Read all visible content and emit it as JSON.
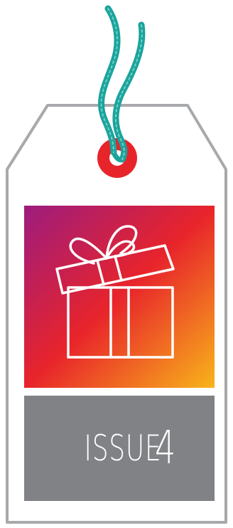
{
  "tag": {
    "issue_word": "ISSUE",
    "issue_number": "4"
  },
  "colors": {
    "tag_outline": "#a7a9ac",
    "tag_fill": "#ffffff",
    "grommet": "#e8242b",
    "string": "#1ba39c",
    "gradient": [
      "#9d1c7e",
      "#e8242b",
      "#f7a51c"
    ],
    "label_band": "#808285",
    "label_text": "#ffffff",
    "gift_icon_stroke": "#ffffff"
  },
  "icons": [
    "gift-box-icon",
    "string-icon",
    "grommet-icon"
  ]
}
